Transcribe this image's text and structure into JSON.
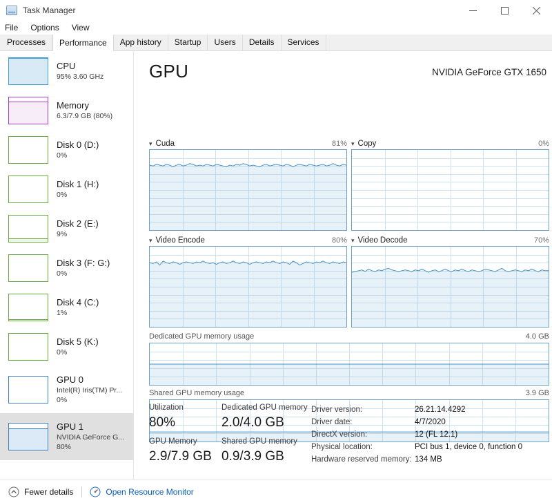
{
  "window": {
    "title": "Task Manager",
    "icon": "task-manager-icon",
    "controls": {
      "minimize": "–",
      "maximize": "□",
      "close": "✕"
    }
  },
  "menu": {
    "items": [
      "File",
      "Options",
      "View"
    ]
  },
  "tabs": {
    "active": "Performance",
    "items": [
      "Processes",
      "Performance",
      "App history",
      "Startup",
      "Users",
      "Details",
      "Services"
    ]
  },
  "sidebar": {
    "items": [
      {
        "name": "CPU",
        "sub": "95%  3.60 GHz",
        "sub2": "",
        "color": "#3f9fd4",
        "fill": "#d7eaf6",
        "level": 95,
        "selected": false
      },
      {
        "name": "Memory",
        "sub": "6.3/7.9 GB (80%)",
        "sub2": "",
        "color": "#a93fc8",
        "fill": "#f6edf9",
        "level": 80,
        "selected": false
      },
      {
        "name": "Disk 0 (D:)",
        "sub": "0%",
        "sub2": "",
        "color": "#6bab41",
        "fill": "#eef6e8",
        "level": 0,
        "selected": false
      },
      {
        "name": "Disk 1 (H:)",
        "sub": "0%",
        "sub2": "",
        "color": "#6bab41",
        "fill": "#eef6e8",
        "level": 0,
        "selected": false
      },
      {
        "name": "Disk 2 (E:)",
        "sub": "9%",
        "sub2": "",
        "color": "#6bab41",
        "fill": "#eef6e8",
        "level": 9,
        "selected": false
      },
      {
        "name": "Disk 3 (F: G:)",
        "sub": "0%",
        "sub2": "",
        "color": "#6bab41",
        "fill": "#eef6e8",
        "level": 0,
        "selected": false
      },
      {
        "name": "Disk 4 (C:)",
        "sub": "1%",
        "sub2": "",
        "color": "#6bab41",
        "fill": "#eef6e8",
        "level": 1,
        "selected": false
      },
      {
        "name": "Disk 5 (K:)",
        "sub": "0%",
        "sub2": "",
        "color": "#6bab41",
        "fill": "#eef6e8",
        "level": 0,
        "selected": false
      },
      {
        "name": "GPU 0",
        "sub": "Intel(R) Iris(TM) Pr...",
        "sub2": "0%",
        "color": "#3f7fc4",
        "fill": "#e8f1fa",
        "level": 0,
        "selected": false
      },
      {
        "name": "GPU 1",
        "sub": "NVIDIA GeForce G...",
        "sub2": "80%",
        "color": "#3f7fc4",
        "fill": "#dbeaf6",
        "level": 80,
        "selected": true
      }
    ]
  },
  "main": {
    "heading": "GPU",
    "model": "NVIDIA GeForce GTX 1650",
    "engine_graphs": [
      {
        "label": "Cuda",
        "value": "81%",
        "chevron": "⌄"
      },
      {
        "label": "Copy",
        "value": "0%",
        "chevron": "⌄"
      },
      {
        "label": "Video Encode",
        "value": "80%",
        "chevron": "⌄"
      },
      {
        "label": "Video Decode",
        "value": "70%",
        "chevron": "⌄"
      }
    ],
    "memory_graphs": [
      {
        "label": "Dedicated GPU memory usage",
        "max": "4.0 GB"
      },
      {
        "label": "Shared GPU memory usage",
        "max": "3.9 GB"
      }
    ],
    "stats": [
      {
        "name": "Utilization",
        "value": "80%"
      },
      {
        "name": "GPU Memory",
        "value": "2.9/7.9 GB"
      },
      {
        "name": "Dedicated GPU memory",
        "value": "2.0/4.0 GB"
      },
      {
        "name": "Shared GPU memory",
        "value": "0.9/3.9 GB"
      }
    ],
    "details": [
      {
        "key": "Driver version:",
        "value": "26.21.14.4292"
      },
      {
        "key": "Driver date:",
        "value": "4/7/2020"
      },
      {
        "key": "DirectX version:",
        "value": "12 (FL 12.1)"
      },
      {
        "key": "Physical location:",
        "value": "PCI bus 1, device 0, function 0"
      },
      {
        "key": "Hardware reserved memory:",
        "value": "134 MB"
      }
    ]
  },
  "statusbar": {
    "fewer_details": "Fewer details",
    "fewer_details_icon": "chevron-up-circle-icon",
    "resource_monitor": "Open Resource Monitor",
    "resource_monitor_icon": "resource-monitor-icon"
  },
  "chart_data": [
    {
      "type": "line",
      "title": "Cuda",
      "ylabel": "Utilization %",
      "ylim": [
        0,
        100
      ],
      "current": 81,
      "values": [
        81,
        80,
        82,
        81,
        80,
        82,
        81,
        79,
        81,
        82,
        80,
        81,
        83,
        82,
        80,
        81,
        80,
        82,
        81,
        80,
        82,
        81,
        80,
        79,
        81,
        80,
        82,
        81,
        83,
        82,
        80,
        81,
        80,
        79,
        81,
        82,
        80,
        81,
        82,
        81,
        80,
        82,
        81,
        79,
        81,
        82,
        81,
        80,
        82,
        81,
        80,
        81,
        82,
        80,
        81,
        83,
        81,
        80,
        82,
        81
      ],
      "grid": true
    },
    {
      "type": "line",
      "title": "Copy",
      "ylabel": "Utilization %",
      "ylim": [
        0,
        100
      ],
      "current": 0,
      "values": [
        0,
        0,
        0,
        0,
        0,
        0,
        0,
        0,
        0,
        0,
        0,
        0,
        0,
        0,
        0,
        0,
        0,
        0,
        0,
        0,
        0,
        0,
        0,
        0,
        0,
        0,
        0,
        0,
        0,
        0,
        0,
        0,
        0,
        0,
        0,
        0,
        0,
        0,
        0,
        0,
        0,
        0,
        0,
        0,
        0,
        0,
        0,
        0,
        0,
        0,
        0,
        0,
        0,
        0,
        0,
        0,
        0,
        0,
        0,
        0
      ],
      "grid": true
    },
    {
      "type": "line",
      "title": "Video Encode",
      "ylabel": "Utilization %",
      "ylim": [
        0,
        100
      ],
      "current": 80,
      "values": [
        80,
        79,
        81,
        77,
        82,
        80,
        79,
        81,
        80,
        78,
        80,
        81,
        80,
        79,
        81,
        80,
        82,
        80,
        79,
        80,
        78,
        80,
        81,
        79,
        80,
        82,
        80,
        79,
        81,
        80,
        78,
        80,
        81,
        80,
        79,
        81,
        80,
        82,
        80,
        79,
        81,
        80,
        78,
        82,
        80,
        77,
        79,
        81,
        80,
        79,
        81,
        80,
        82,
        80,
        79,
        81,
        80,
        79,
        81,
        80
      ],
      "grid": true
    },
    {
      "type": "line",
      "title": "Video Decode",
      "ylabel": "Utilization %",
      "ylim": [
        0,
        100
      ],
      "current": 70,
      "values": [
        68,
        69,
        70,
        71,
        69,
        72,
        70,
        69,
        71,
        70,
        72,
        73,
        71,
        70,
        69,
        70,
        71,
        70,
        69,
        71,
        70,
        72,
        70,
        68,
        70,
        71,
        69,
        70,
        72,
        70,
        69,
        71,
        70,
        72,
        70,
        69,
        71,
        70,
        69,
        70,
        72,
        71,
        70,
        69,
        71,
        73,
        70,
        69,
        70,
        71,
        70,
        69,
        71,
        70,
        72,
        70,
        69,
        71,
        70,
        70
      ],
      "grid": true
    },
    {
      "type": "area",
      "title": "Dedicated GPU memory usage",
      "ylabel": "GB",
      "ylim": [
        0,
        4.0
      ],
      "current": 2.0,
      "values": [
        2.0,
        2.0,
        2.0,
        2.0,
        2.0,
        2.0,
        2.0,
        2.0,
        2.0,
        2.0,
        2.0,
        2.0,
        2.0,
        2.0,
        2.0,
        2.0,
        2.0,
        2.0,
        2.0,
        2.0,
        2.0,
        2.0,
        2.0,
        2.0,
        2.0,
        2.0,
        2.0,
        2.0,
        2.0,
        2.0,
        2.0,
        2.0,
        2.0,
        2.0,
        2.0,
        2.0,
        2.0,
        2.0,
        2.0,
        2.0,
        2.0,
        2.0,
        2.0,
        2.0,
        2.0,
        2.0,
        2.0,
        2.0,
        2.0,
        2.0,
        2.0,
        2.0,
        2.0,
        2.0,
        2.0,
        2.0,
        2.0,
        2.0,
        2.0,
        2.0
      ],
      "grid": true
    },
    {
      "type": "area",
      "title": "Shared GPU memory usage",
      "ylabel": "GB",
      "ylim": [
        0,
        3.9
      ],
      "current": 0.9,
      "values": [
        0.9,
        0.9,
        0.9,
        0.9,
        0.9,
        0.9,
        0.9,
        0.9,
        0.9,
        0.9,
        0.9,
        0.9,
        0.9,
        0.9,
        0.9,
        0.9,
        0.9,
        0.9,
        0.9,
        0.9,
        0.9,
        0.9,
        0.9,
        0.9,
        0.9,
        0.9,
        0.9,
        0.9,
        0.9,
        0.9,
        0.9,
        0.9,
        0.9,
        0.9,
        0.9,
        0.9,
        0.9,
        0.9,
        0.9,
        0.9,
        0.9,
        0.9,
        0.9,
        0.9,
        0.9,
        0.9,
        0.9,
        0.9,
        0.9,
        0.9,
        0.9,
        0.9,
        0.9,
        0.9,
        0.9,
        0.9,
        0.9,
        0.9,
        0.9,
        0.9
      ],
      "grid": true
    }
  ]
}
